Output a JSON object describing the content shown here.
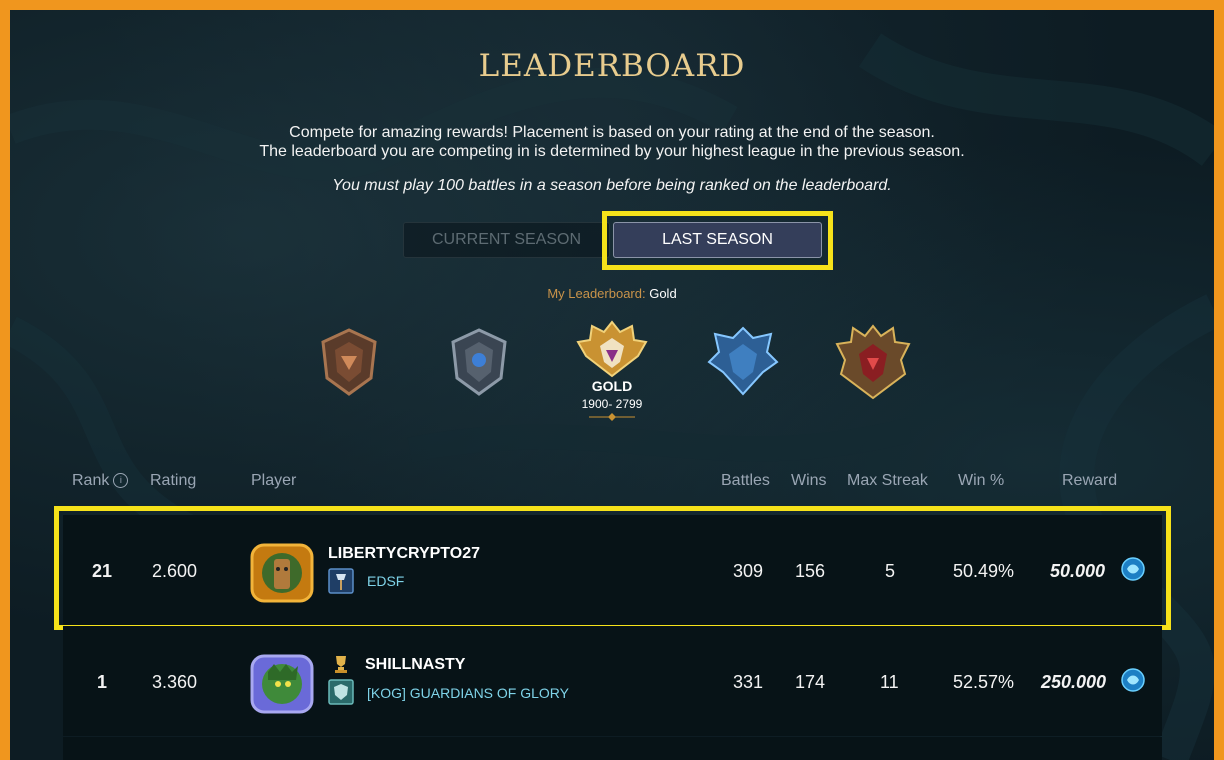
{
  "header": {
    "title": "LEADERBOARD",
    "intro_line1": "Compete for amazing rewards! Placement is based on your rating at the end of the season.",
    "intro_line2": "The leaderboard you are competing in is determined by your highest league in the previous season.",
    "requirement": "You must play 100 battles in a season before being ranked on the leaderboard."
  },
  "tabs": [
    {
      "label": "CURRENT SEASON",
      "active": false
    },
    {
      "label": "LAST SEASON",
      "active": true
    }
  ],
  "my_leaderboard": {
    "label": "My Leaderboard:",
    "value": "Gold"
  },
  "leagues": {
    "icons": [
      "bronze-league-icon",
      "silver-league-icon",
      "gold-league-icon",
      "diamond-league-icon",
      "champion-league-icon"
    ],
    "selected": {
      "name": "GOLD",
      "range": "1900- 2799"
    }
  },
  "table": {
    "columns": {
      "rank": "Rank",
      "rating": "Rating",
      "player": "Player",
      "battles": "Battles",
      "wins": "Wins",
      "max_streak": "Max Streak",
      "win_pct": "Win %",
      "reward": "Reward"
    },
    "rows": [
      {
        "rank": "21",
        "rating": "2.600",
        "player": "LIBERTYCRYPTO27",
        "guild": "EDSF",
        "battles": "309",
        "wins": "156",
        "max_streak": "5",
        "win_pct": "50.49%",
        "reward": "50.000",
        "highlighted": true
      },
      {
        "rank": "1",
        "rating": "3.360",
        "player": "SHILLNASTY",
        "guild": "[KOG] GUARDIANS OF GLORY",
        "battles": "331",
        "wins": "174",
        "max_streak": "11",
        "win_pct": "52.57%",
        "reward": "250.000",
        "highlighted": false
      }
    ]
  },
  "colors": {
    "highlight": "#f6e21a",
    "frame": "#f0961e",
    "title_gold": "#e8cc8e",
    "guild_cyan": "#7fd3e8",
    "background": "#0d1c23"
  }
}
